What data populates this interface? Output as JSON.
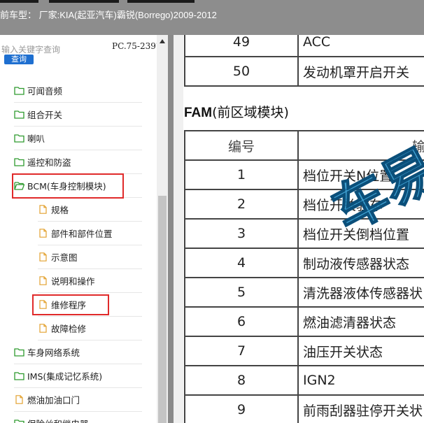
{
  "titlebar": {
    "text": "前车型： 厂家:KIA(起亚汽车)霸锐(Borrego)2009-2012"
  },
  "search": {
    "placeholder": "输入关键字查询",
    "button_label": "查询",
    "code": "PC.75-2397"
  },
  "tree": [
    {
      "label": "可闻音频",
      "type": "folder",
      "icon": "folder-icon"
    },
    {
      "label": "组合开关",
      "type": "folder",
      "icon": "folder-icon"
    },
    {
      "label": "喇叭",
      "type": "folder",
      "icon": "folder-icon"
    },
    {
      "label": "遥控和防盗",
      "type": "folder",
      "icon": "folder-icon"
    },
    {
      "label": "BCM(车身控制模块)",
      "type": "folder-open",
      "icon": "folder-open-icon",
      "highlighted": true
    },
    {
      "label": "规格",
      "type": "doc",
      "icon": "document-icon"
    },
    {
      "label": "部件和部件位置",
      "type": "doc",
      "icon": "document-icon"
    },
    {
      "label": "示意图",
      "type": "doc",
      "icon": "document-icon"
    },
    {
      "label": "说明和操作",
      "type": "doc",
      "icon": "document-icon"
    },
    {
      "label": "维修程序",
      "type": "doc",
      "icon": "document-icon",
      "highlighted": true
    },
    {
      "label": "故障检修",
      "type": "doc",
      "icon": "document-icon"
    },
    {
      "label": "车身网络系统",
      "type": "folder",
      "icon": "folder-icon"
    },
    {
      "label": "IMS(集成记忆系统)",
      "type": "folder",
      "icon": "folder-icon"
    },
    {
      "label": "燃油加油口门",
      "type": "doc",
      "icon": "document-icon"
    },
    {
      "label": "保险丝和继电器",
      "type": "folder",
      "icon": "folder-icon"
    }
  ],
  "document": {
    "top_rows": [
      {
        "num": "49",
        "name": "ACC"
      },
      {
        "num": "50",
        "name": "发动机罩开启开关"
      }
    ],
    "section_title_bold": "FAM",
    "section_title_rest": "(前区域模块)",
    "header": {
      "num": "编号",
      "name": "输"
    },
    "rows": [
      {
        "num": "1",
        "name": "档位开关N位置"
      },
      {
        "num": "2",
        "name": "档位开关驻车"
      },
      {
        "num": "3",
        "name": "档位开关倒档位置"
      },
      {
        "num": "4",
        "name": "制动液传感器状态"
      },
      {
        "num": "5",
        "name": "清洗器液体传感器状"
      },
      {
        "num": "6",
        "name": "燃油滤清器状态"
      },
      {
        "num": "7",
        "name": "油压开关状态"
      },
      {
        "num": "8",
        "name": "IGN2"
      },
      {
        "num": "9",
        "name": "前雨刮器驻停开关状"
      }
    ]
  },
  "colors": {
    "titlebar": "#8d8d8d",
    "highlight": "#e02a2a",
    "button": "#1e6fd0",
    "watermark": "#1f8fc9"
  }
}
